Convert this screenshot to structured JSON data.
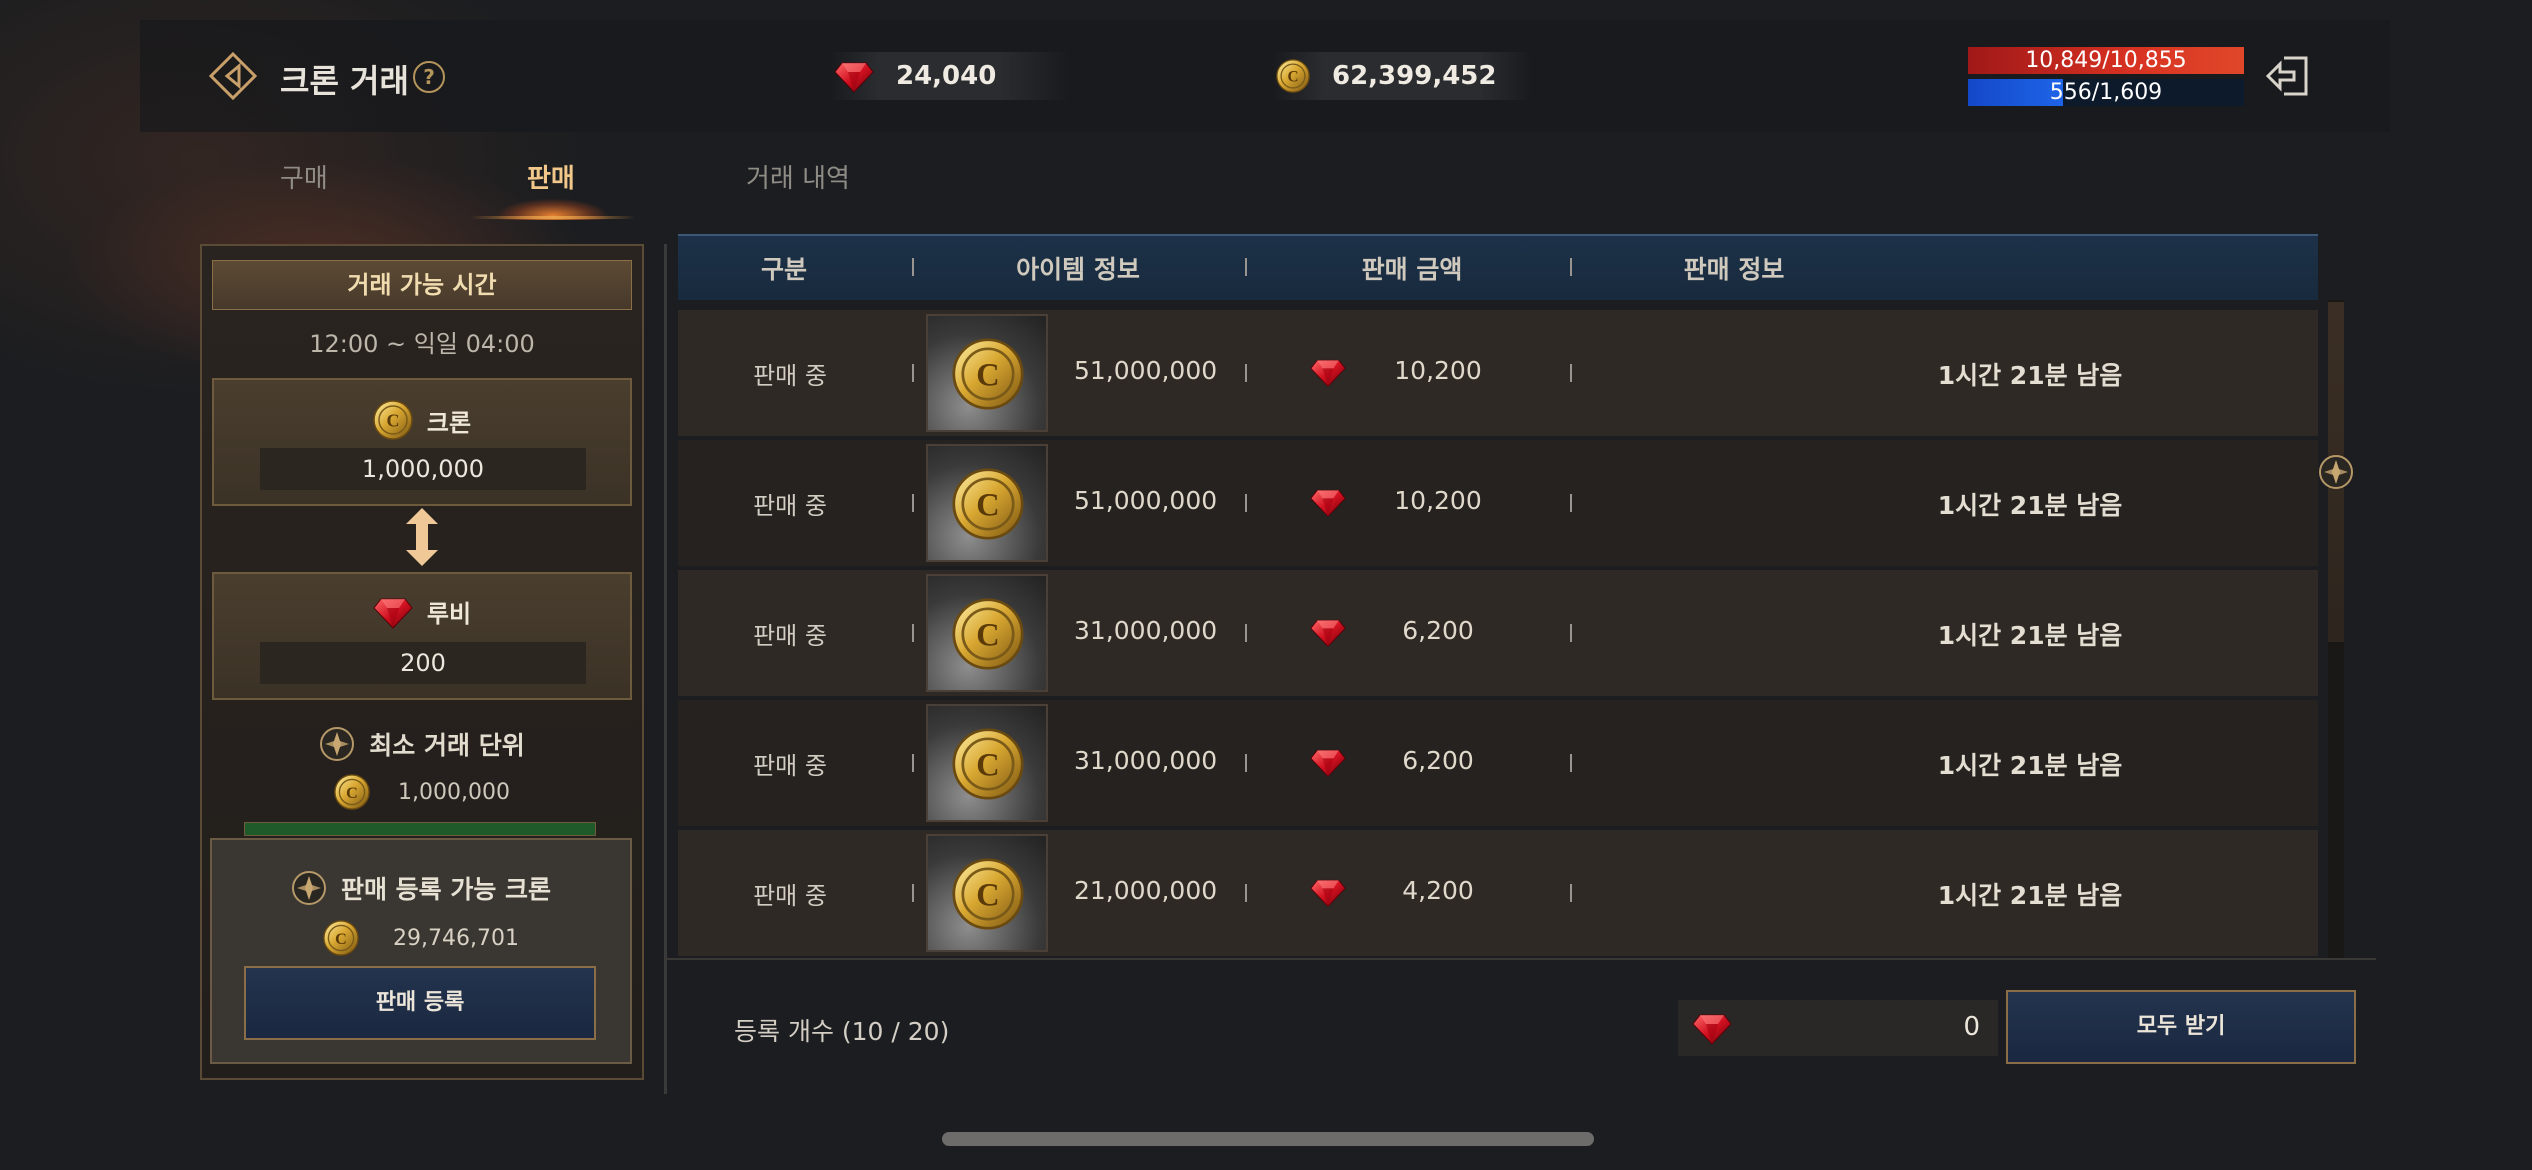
{
  "header": {
    "title": "크론 거래",
    "help_icon": "?",
    "ruby_balance": "24,040",
    "cron_balance": "62,399,452",
    "hp": "10,849/10,855",
    "mp": "556/1,609",
    "mp_fraction": 0.345
  },
  "tabs": [
    {
      "label": "구매",
      "active": false
    },
    {
      "label": "판매",
      "active": true
    },
    {
      "label": "거래 내역",
      "active": false
    }
  ],
  "left_panel": {
    "header": "거래 가능 시간",
    "time_range": "12:00 ~ 익일 04:00",
    "cron_label": "크론",
    "cron_amount": "1,000,000",
    "ruby_label": "루비",
    "ruby_amount": "200",
    "min_unit_label": "최소 거래 단위",
    "min_unit_value": "1,000,000",
    "sellable_label": "판매 등록 가능 크론",
    "sellable_value": "29,746,701",
    "sell_button": "판매 등록"
  },
  "table": {
    "headers": [
      "구분",
      "아이템 정보",
      "판매 금액",
      "판매 정보"
    ],
    "rows": [
      {
        "status": "판매 중",
        "cron": "51,000,000",
        "ruby": "10,200",
        "remaining": "1시간 21분 남음"
      },
      {
        "status": "판매 중",
        "cron": "51,000,000",
        "ruby": "10,200",
        "remaining": "1시간 21분 남음"
      },
      {
        "status": "판매 중",
        "cron": "31,000,000",
        "ruby": "6,200",
        "remaining": "1시간 21분 남음"
      },
      {
        "status": "판매 중",
        "cron": "31,000,000",
        "ruby": "6,200",
        "remaining": "1시간 21분 남음"
      },
      {
        "status": "판매 중",
        "cron": "21,000,000",
        "ruby": "4,200",
        "remaining": "1시간 21분 남음"
      }
    ]
  },
  "footer": {
    "registered_count": "등록 개수 (10 / 20)",
    "receivable": "0",
    "receive_all_button": "모두 받기"
  },
  "colors": {
    "accent_gold": "#f2c88a",
    "hp_red": "#d83222",
    "mp_blue": "#1e64e8",
    "button_blue": "#1a2740"
  },
  "icons": [
    "back-icon",
    "help-icon",
    "ruby-icon",
    "cron-coin-icon",
    "exit-icon",
    "swap-arrow-icon",
    "emblem-icon"
  ]
}
